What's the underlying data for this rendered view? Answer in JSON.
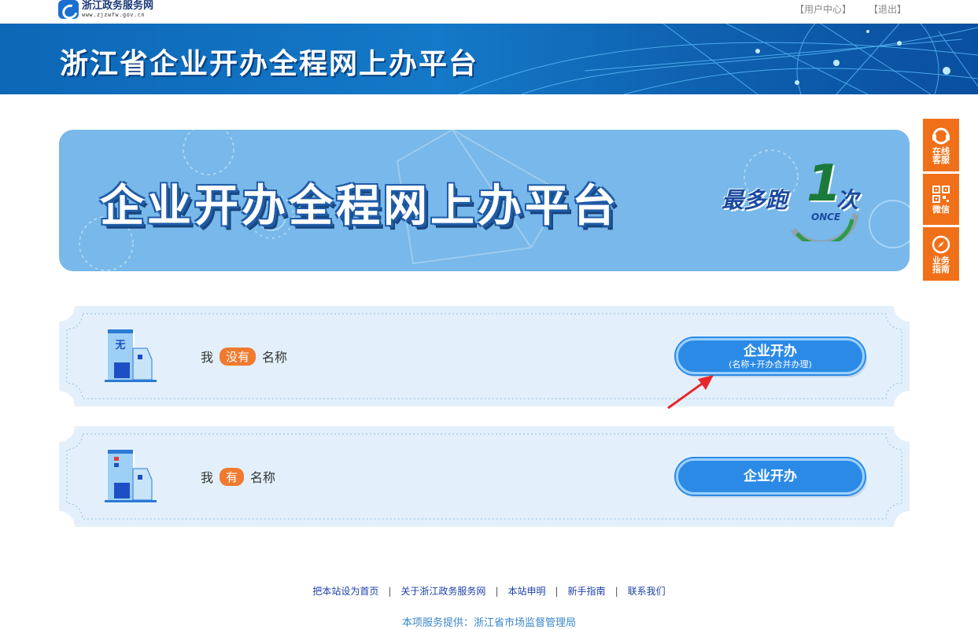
{
  "top": {
    "logo_title": "浙江政务服务网",
    "logo_url": "www.zjzwfw.gov.cn",
    "user_center": "【用户中心】",
    "logout": "【退出】"
  },
  "header": {
    "title": "浙江省企业开办全程网上办平台"
  },
  "hero": {
    "title": "企业开办全程网上办平台",
    "slogan_prefix": "最多跑",
    "slogan_number": "1",
    "slogan_suffix": "次",
    "slogan_once": "ONCE"
  },
  "options": [
    {
      "building_char": "无",
      "text_before": "我",
      "badge": "没有",
      "text_after": "名称",
      "button_label": "企业开办",
      "button_sub": "(名称+开办合并办理)"
    },
    {
      "text_before": "我",
      "badge": "有",
      "text_after": "名称",
      "button_label": "企业开办"
    }
  ],
  "side": {
    "online_service": "在线客服",
    "wechat": "微信",
    "guide": "业务指南"
  },
  "footer": {
    "links": [
      "把本站设为首页",
      "关于浙江政务服务网",
      "本站申明",
      "新手指南",
      "联系我们"
    ],
    "separator": "|",
    "provider": "本项服务提供：浙江省市场监督管理局"
  },
  "colors": {
    "header_blue": "#1479c8",
    "hero_blue": "#78b8ea",
    "accent_orange": "#f07019",
    "button_blue": "#2b8ae6",
    "card_bg": "#e3f0fb"
  }
}
